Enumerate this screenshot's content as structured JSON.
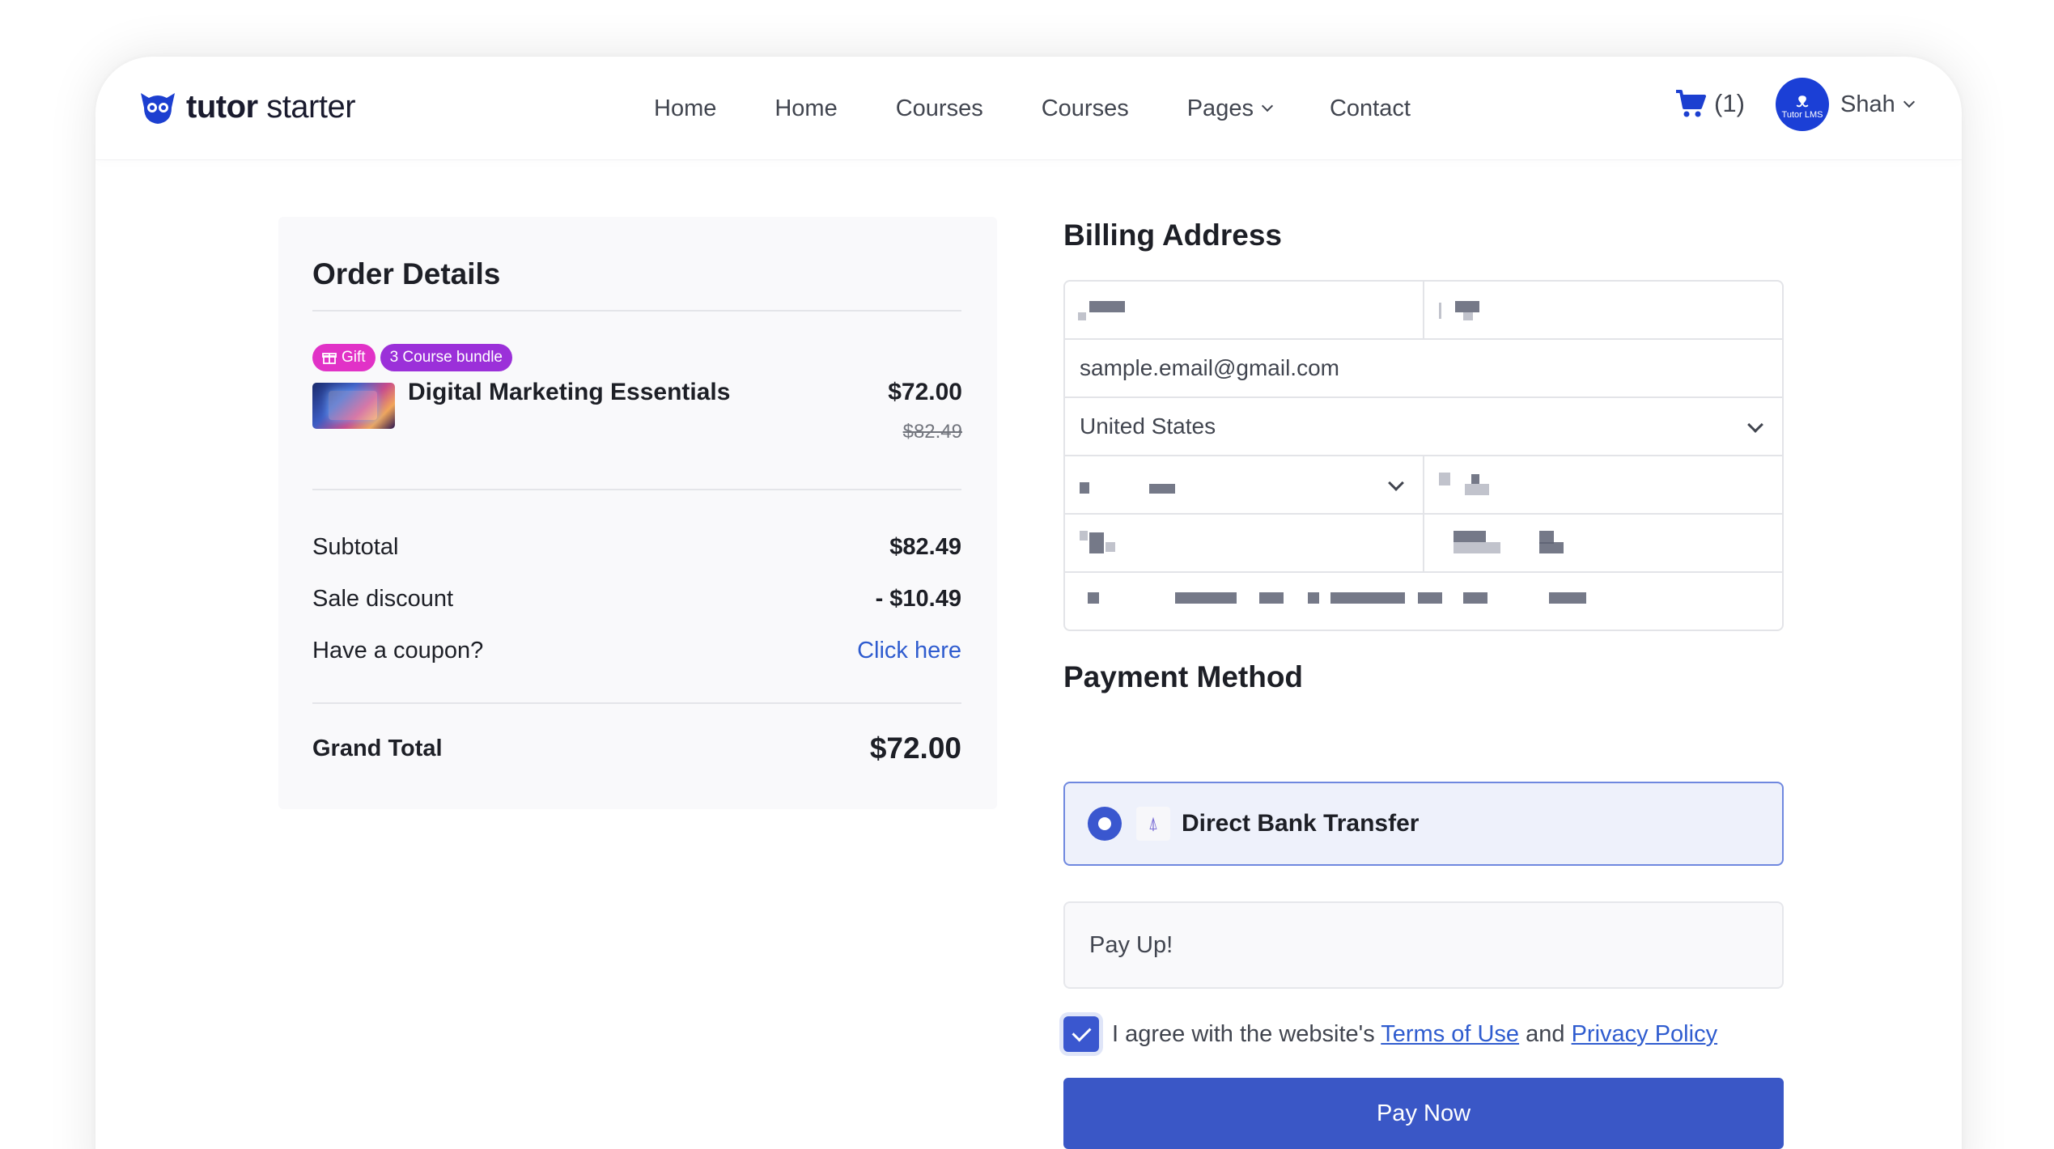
{
  "header": {
    "logo": {
      "part1": "tutor",
      "part2": " starter"
    },
    "nav": [
      {
        "label": "Home"
      },
      {
        "label": "Home"
      },
      {
        "label": "Courses"
      },
      {
        "label": "Courses"
      },
      {
        "label": "Pages"
      },
      {
        "label": "Contact"
      }
    ],
    "cart_count": "(1)",
    "avatar_text": "Tutor LMS",
    "user_name": "Shah"
  },
  "order": {
    "title": "Order Details",
    "badges": {
      "gift": "Gift",
      "bundle": "3 Course bundle"
    },
    "item": {
      "name": "Digital Marketing Essentials",
      "price": "$72.00",
      "old_price": "$82.49"
    },
    "subtotal": {
      "label": "Subtotal",
      "value": "$82.49"
    },
    "discount": {
      "label": "Sale discount",
      "value": "- $10.49"
    },
    "coupon": {
      "label": "Have a coupon?",
      "link": "Click here"
    },
    "grand_total": {
      "label": "Grand Total",
      "value": "$72.00"
    }
  },
  "billing": {
    "title": "Billing Address",
    "email": "sample.email@gmail.com",
    "country": "United States"
  },
  "payment": {
    "title": "Payment Method",
    "option": "Direct Bank Transfer",
    "instructions": "Pay Up!",
    "agree_prefix": "I agree with the website's ",
    "terms": "Terms of Use",
    "and": " and ",
    "privacy": "Privacy Policy",
    "button": "Pay Now"
  },
  "colors": {
    "primary": "#3a57c6",
    "gift_badge": "#e132c7",
    "bundle_badge": "#9b30d9",
    "link": "#2f5ccf"
  }
}
